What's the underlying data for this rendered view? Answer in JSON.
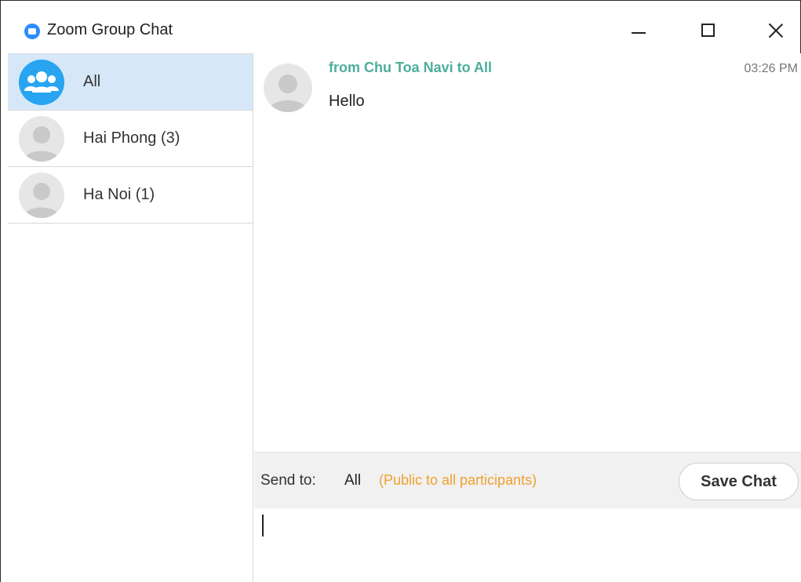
{
  "window": {
    "title": "Zoom Group Chat",
    "icons": {
      "app": "zoom-logo-icon",
      "minimize": "minimize-icon",
      "maximize": "maximize-icon",
      "close": "close-icon"
    }
  },
  "sidebar": {
    "items": [
      {
        "label": "All",
        "avatar": "group-icon",
        "active": true
      },
      {
        "label": "Hai Phong (3)",
        "avatar": "person-avatar-icon",
        "active": false
      },
      {
        "label": "Ha Noi (1)",
        "avatar": "person-avatar-icon",
        "active": false
      }
    ]
  },
  "messages": [
    {
      "sender": "from Chu Toa Navi to All",
      "time": "03:26 PM",
      "text": "Hello",
      "avatar": "person-avatar-icon"
    }
  ],
  "sendbar": {
    "label": "Send to:",
    "target": "All",
    "note": "(Public to all participants)",
    "save_label": "Save Chat"
  },
  "colors": {
    "accent": "#2d8cff",
    "active_item_bg": "#d6e8f8",
    "sender_color": "#4dae9c",
    "note_color": "#f0a030"
  }
}
